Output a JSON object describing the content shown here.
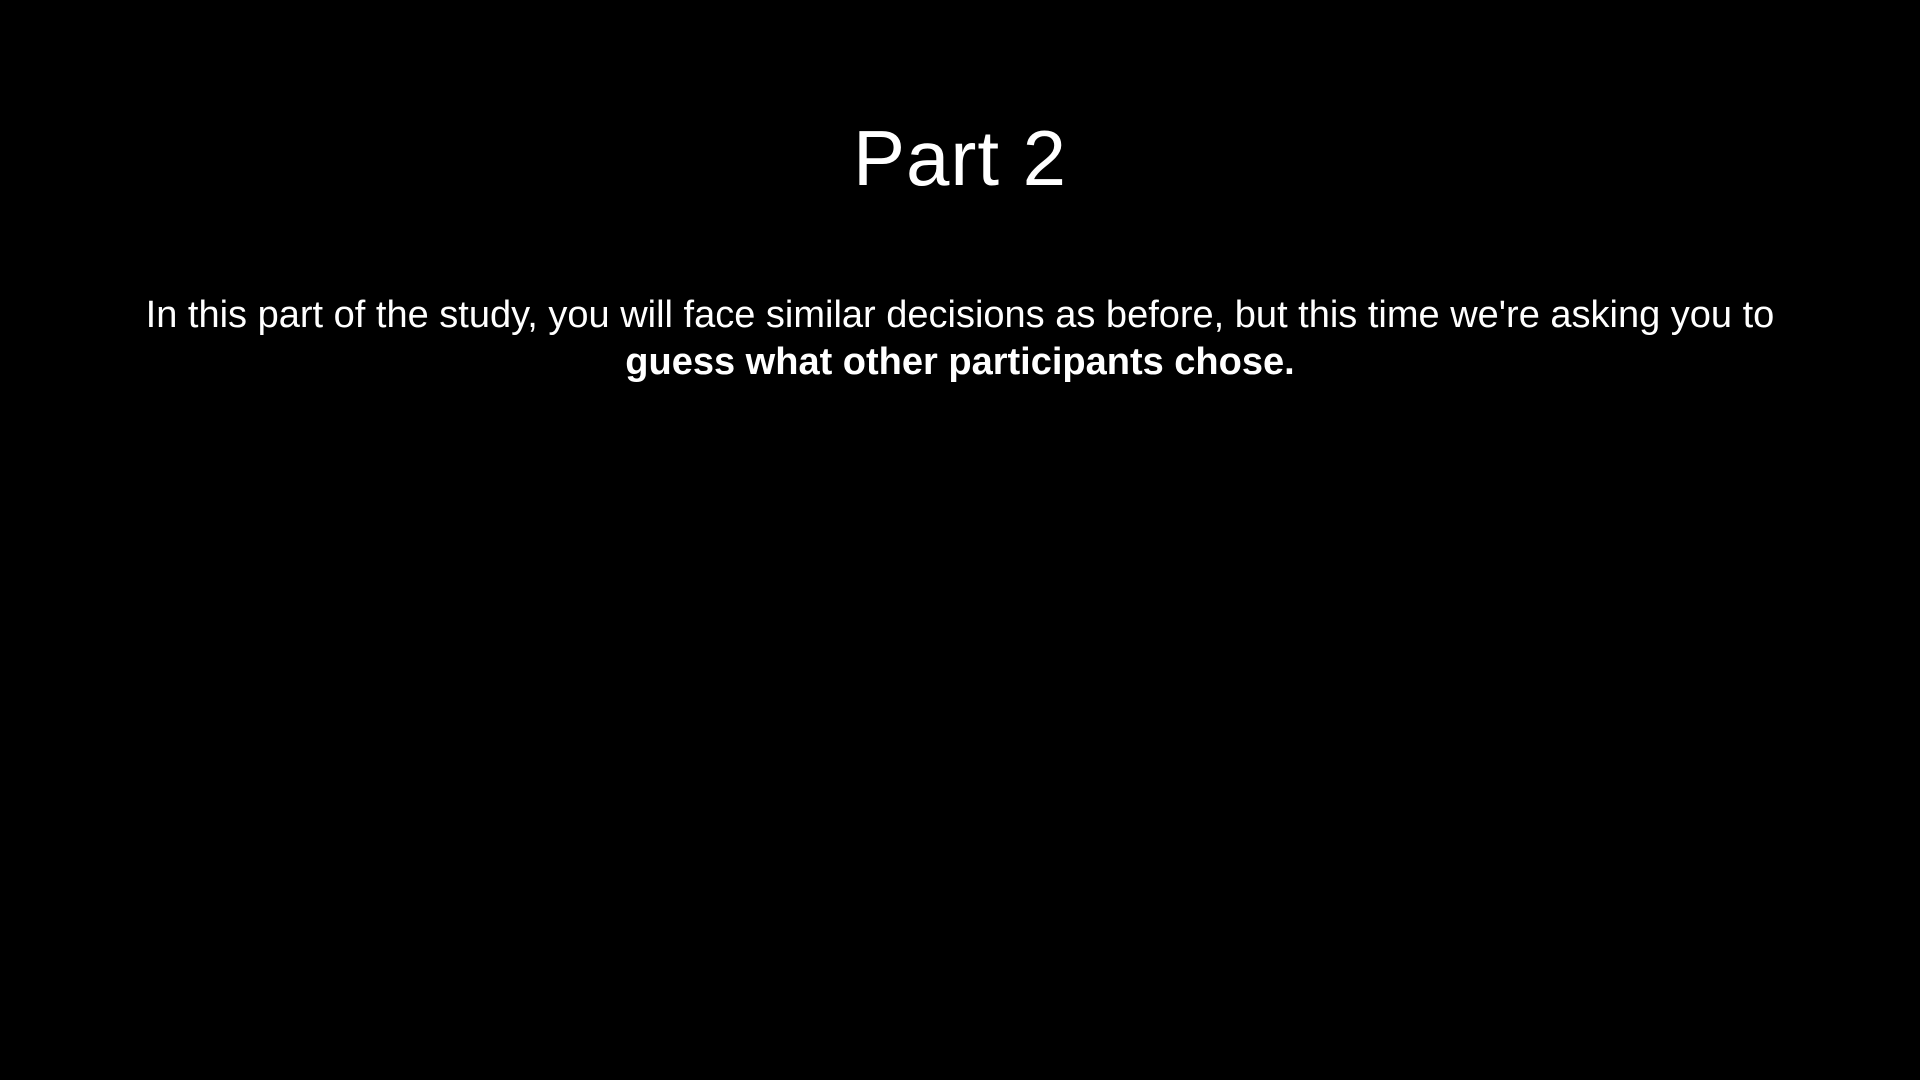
{
  "slide": {
    "title": "Part 2",
    "body_intro": "In this part of the study, you will face similar decisions as before, but this time we're asking you to ",
    "body_emphasis": "guess what other participants chose."
  },
  "colors": {
    "background": "#000000",
    "text": "#ffffff"
  }
}
